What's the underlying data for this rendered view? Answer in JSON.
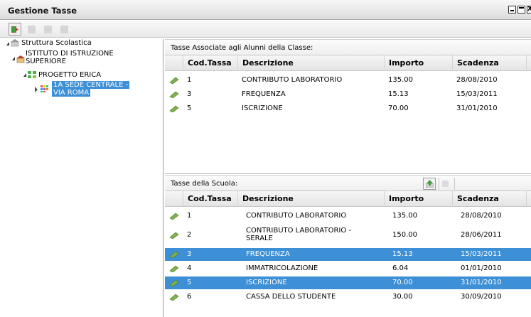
{
  "window": {
    "title": "Gestione Tasse"
  },
  "toolbar": {
    "buttons": [
      {
        "name": "exit-icon",
        "state": "active"
      },
      {
        "name": "add-icon",
        "state": "disabled"
      },
      {
        "name": "edit-icon",
        "state": "disabled"
      },
      {
        "name": "delete-icon",
        "state": "disabled"
      }
    ]
  },
  "tree": {
    "root": "Struttura Scolastica",
    "institute": "ISTITUTO DI ISTRUZIONE SUPERIORE",
    "institute_line1": "ISTITUTO DI ISTRUZIONE",
    "institute_line2": "SUPERIORE",
    "project": "PROGETTO ERICA",
    "class_line1": "1A SEDE CENTRALE -",
    "class_line2": "VIA ROMA"
  },
  "associated": {
    "header": "Tasse Associate agli Alunni della Classe:",
    "columns": {
      "code": "Cod.Tassa",
      "desc": "Descrizione",
      "amount": "Importo",
      "due": "Scadenza"
    },
    "rows": [
      {
        "code": "1",
        "desc": "CONTRIBUTO LABORATORIO",
        "amount": "135.00",
        "due": "28/08/2010"
      },
      {
        "code": "3",
        "desc": "FREQUENZA",
        "amount": "15.13",
        "due": "15/03/2011"
      },
      {
        "code": "5",
        "desc": "ISCRIZIONE",
        "amount": "70.00",
        "due": "31/01/2010"
      }
    ]
  },
  "school": {
    "header": "Tasse della Scuola:",
    "columns": {
      "code": "Cod.Tassa",
      "desc": "Descrizione",
      "amount": "Importo",
      "due": "Scadenza"
    },
    "rows": [
      {
        "code": "1",
        "desc": "CONTRIBUTO LABORATORIO",
        "amount": "135.00",
        "due": "28/08/2010",
        "selected": false
      },
      {
        "code": "2",
        "desc_line1": "CONTRIBUTO LABORATORIO -",
        "desc_line2": "SERALE",
        "amount": "150.00",
        "due": "28/06/2011",
        "selected": false
      },
      {
        "code": "3",
        "desc": "FREQUENZA",
        "amount": "15.13",
        "due": "15/03/2011",
        "selected": true
      },
      {
        "code": "4",
        "desc": "IMMATRICOLAZIONE",
        "amount": "6.04",
        "due": "01/01/2010",
        "selected": false
      },
      {
        "code": "5",
        "desc": "ISCRIZIONE",
        "amount": "70.00",
        "due": "31/01/2010",
        "selected": true
      },
      {
        "code": "6",
        "desc": "CASSA DELLO STUDENTE",
        "amount": "30.00",
        "due": "30/09/2010",
        "selected": false
      }
    ]
  },
  "colors": {
    "selection": "#3d8fd6",
    "money_icon": "#7fb24a"
  }
}
